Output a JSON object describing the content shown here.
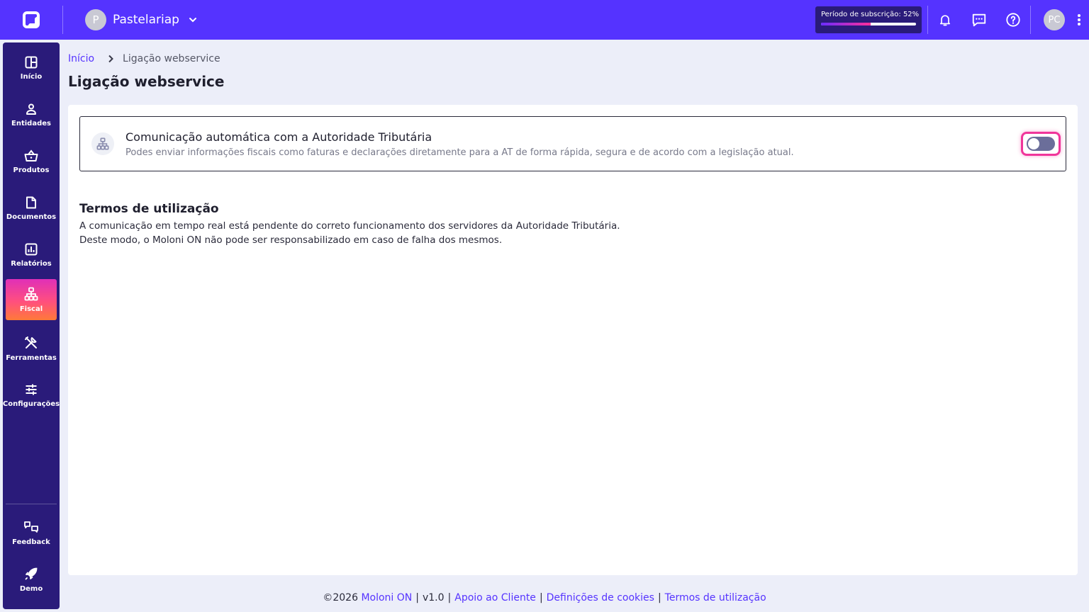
{
  "topbar": {
    "company_initial": "P",
    "company_name": "Pastelariap",
    "subscription_label": "Período de subscrição: 52%",
    "subscription_progress": 0.52,
    "user_initials": "PC"
  },
  "sidebar": {
    "items": [
      {
        "label": "Início",
        "icon": "dashboard-icon"
      },
      {
        "label": "Entidades",
        "icon": "user-icon"
      },
      {
        "label": "Produtos",
        "icon": "basket-icon"
      },
      {
        "label": "Documentos",
        "icon": "document-icon"
      },
      {
        "label": "Relatórios",
        "icon": "chart-icon"
      },
      {
        "label": "Fiscal",
        "icon": "fiscal-network-icon",
        "active": true
      },
      {
        "label": "Ferramentas",
        "icon": "tools-icon"
      },
      {
        "label": "Configurações",
        "icon": "sliders-icon"
      }
    ],
    "bottom_items": [
      {
        "label": "Feedback",
        "icon": "feedback-icon"
      },
      {
        "label": "Demo",
        "icon": "rocket-icon"
      }
    ]
  },
  "breadcrumb": {
    "home": "Início",
    "current": "Ligação webservice"
  },
  "page": {
    "title": "Ligação webservice"
  },
  "webservice": {
    "title": "Comunicação automática com a Autoridade Tributária",
    "description": "Podes enviar informações fiscais como faturas e declarações diretamente para a AT de forma rápida, segura e de acordo com a legislação atual.",
    "enabled": false
  },
  "terms": {
    "title": "Termos de utilização",
    "line1": "A comunicação em tempo real está pendente do correto funcionamento dos servidores da Autoridade Tributária.",
    "line2": "Deste modo, o Moloni ON não pode ser responsabilizado em caso de falha dos mesmos."
  },
  "footer": {
    "copyright": "©2026",
    "brand": "Moloni ON",
    "version": "v1.0",
    "support": "Apoio ao Cliente",
    "cookies": "Definições de cookies",
    "terms": "Termos de utilização"
  },
  "colors": {
    "primary": "#5533ff",
    "sidebar": "#2a1b7a",
    "toggle_highlight": "#f0359a"
  }
}
